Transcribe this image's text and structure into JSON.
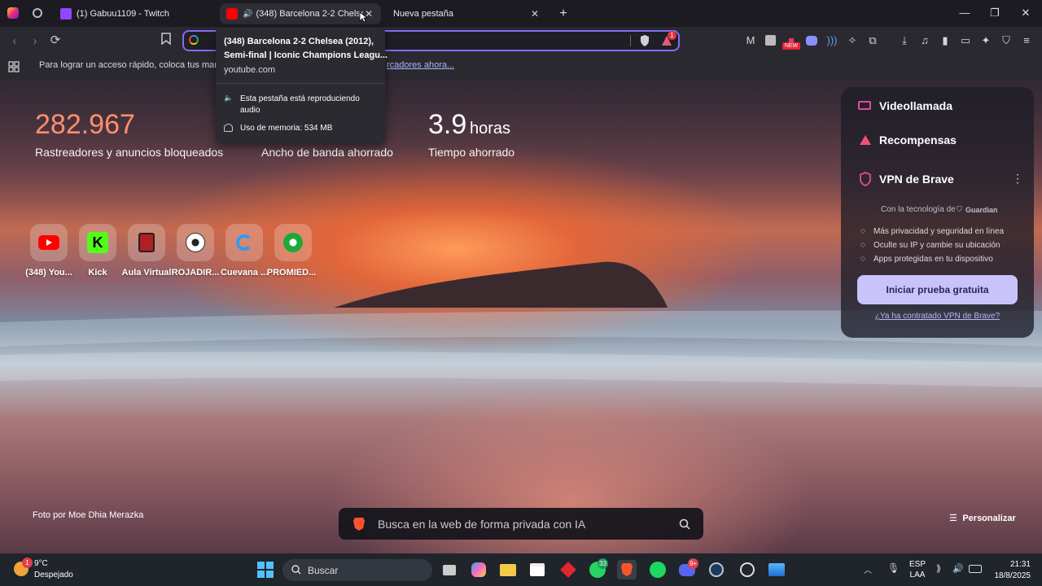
{
  "tabs": [
    {
      "title": "(1) Gabuu1109 - Twitch"
    },
    {
      "title": "(348) Barcelona 2-2 Chelsea (2012), Semi-final | Iconic Champions League"
    },
    {
      "title": "Nueva pestaña"
    }
  ],
  "tooltip": {
    "title_line1": "(348) Barcelona 2-2 Chelsea (2012),",
    "title_line2": "Semi-final | Iconic Champions Leagu...",
    "domain": "youtube.com",
    "audio_line1": "Esta pestaña está reproduciendo",
    "audio_line2": "audio",
    "memory": "Uso de memoria: 534 MB"
  },
  "bookmarks_bar": {
    "text_start": "Para lograr un acceso rápido, coloca tus marcado",
    "text_end": "rcadores ahora..."
  },
  "extensions": {
    "new_badge": "NEW",
    "rewards_count": "1"
  },
  "stats": [
    {
      "value": "282.967",
      "unit": "",
      "label": "Rastreadores y anuncios bloqueados",
      "color": "#ff8f6f"
    },
    {
      "value": "",
      "unit": "",
      "label": "Ancho de banda ahorrado",
      "color": "#ffffff"
    },
    {
      "value": "3.9",
      "unit": "horas",
      "label": "Tiempo ahorrado",
      "color": "#ffffff"
    }
  ],
  "top_sites": [
    {
      "label": "(348) You...",
      "icon": "youtube-icon"
    },
    {
      "label": "Kick",
      "icon": "kick-icon"
    },
    {
      "label": "Aula Virtual",
      "icon": "aula-virtual-icon"
    },
    {
      "label": "ROJADIR...",
      "icon": "soccer-ball-icon"
    },
    {
      "label": "Cuevana ...",
      "icon": "cuevana-icon"
    },
    {
      "label": "PROMIED...",
      "icon": "green-soccer-icon"
    }
  ],
  "panel": {
    "videocall": "Videollamada",
    "rewards": "Recompensas",
    "vpn_title": "VPN de Brave",
    "powered_by": "Con la tecnología de",
    "guardian": "Guardian",
    "features": [
      "Más privacidad y seguridad en línea",
      "Oculte su IP y cambie su ubicación",
      "Apps protegidas en tu dispositivo"
    ],
    "cta": "Iniciar prueba gratuita",
    "already": "¿Ya ha contratado VPN de Brave?"
  },
  "photo_credit": "Foto por Moe Dhia Merazka",
  "search": {
    "placeholder": "Busca en la web de forma privada con IA"
  },
  "customize": "Personalizar",
  "taskbar": {
    "weather_temp": "9°C",
    "weather_desc": "Despejado",
    "weather_badge": "1",
    "search_label": "Buscar",
    "whatsapp_badge": "33",
    "discord_badge": "9+",
    "lang_line1": "ESP",
    "lang_line2": "LAA",
    "time": "21:31",
    "date": "18/8/2025"
  }
}
